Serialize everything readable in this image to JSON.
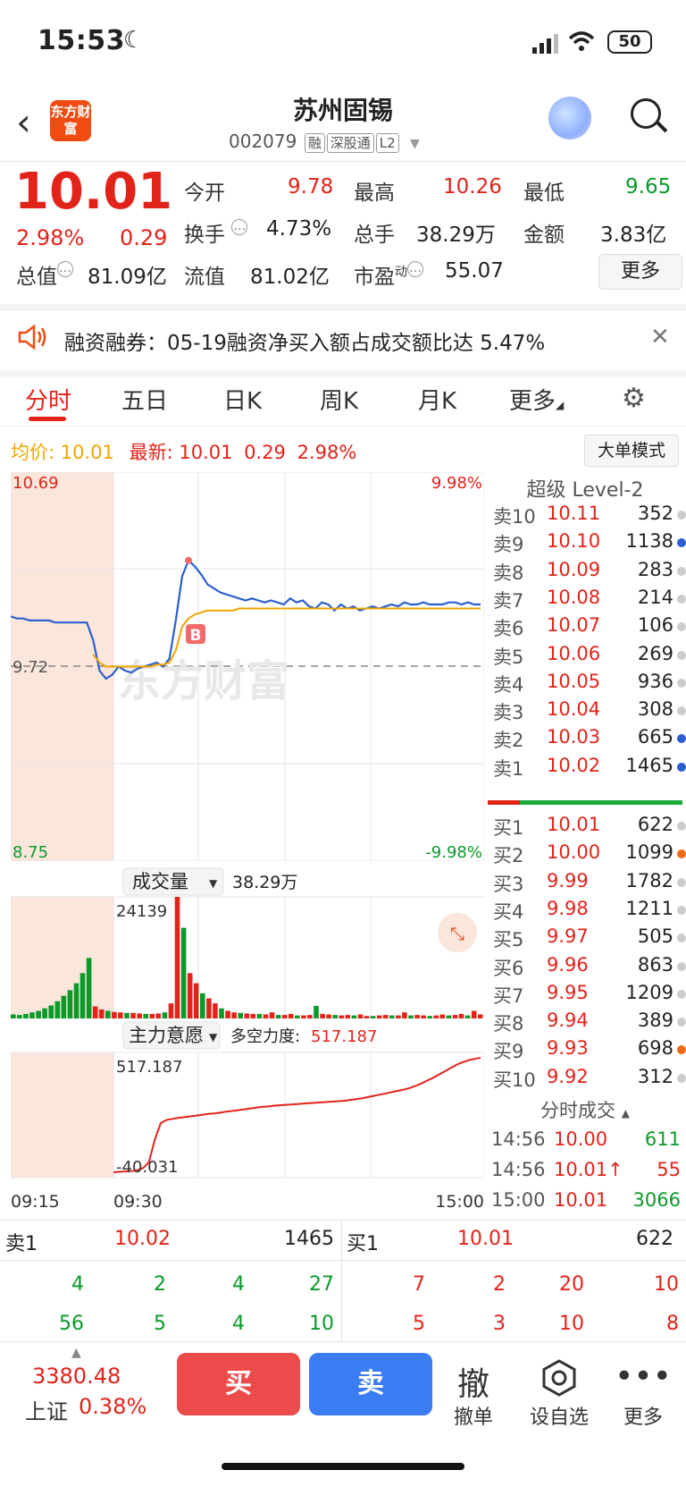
{
  "status_bar": {
    "time": "15:53",
    "battery": "50"
  },
  "header": {
    "logo_text": "东方财富",
    "stock_name": "苏州固锡",
    "stock_code": "002079",
    "tags": [
      "融",
      "深股通",
      "L2"
    ]
  },
  "quote": {
    "price": "10.01",
    "change_pct": "2.98%",
    "change": "0.29",
    "open_label": "今开",
    "open": "9.78",
    "high_label": "最高",
    "high": "10.26",
    "low_label": "最低",
    "low": "9.65",
    "turnover_label": "换手",
    "turnover": "4.73%",
    "volume_label": "总手",
    "volume": "38.29万",
    "amount_label": "金额",
    "amount": "3.83亿",
    "mktcap_label": "总值",
    "mktcap": "81.09亿",
    "float_label": "流值",
    "float_cap": "81.02亿",
    "pe_label": "市盈",
    "pe_sup": "动",
    "pe": "55.07",
    "more_label": "更多"
  },
  "notice": {
    "text": "融资融券：05-19融资净买入额占成交额比达 5.47%"
  },
  "tabs": [
    "分时",
    "五日",
    "日K",
    "周K",
    "月K",
    "更多"
  ],
  "avg_row": {
    "avg_label": "均价:",
    "avg": "10.01",
    "latest_label": "最新:",
    "latest": "10.01",
    "latest_chg": "0.29",
    "latest_pct": "2.98%",
    "big_mode": "大单模式"
  },
  "chart_data": [
    {
      "type": "line",
      "name": "intraday",
      "y_top_label": "10.69",
      "y_mid_label": "9.72",
      "y_bottom_label": "8.75",
      "pct_top_label": "9.98%",
      "pct_bottom_label": "-9.98%",
      "ylim": [
        8.75,
        10.69
      ],
      "prev_close": 9.72,
      "watermark": "东方财富",
      "buy_marker": "B",
      "x_labels": [
        "09:15",
        "09:30",
        "15:00"
      ],
      "series": [
        {
          "name": "price",
          "color": "#2b5fcf",
          "values": [
            9.97,
            9.96,
            9.96,
            9.95,
            9.95,
            9.95,
            9.95,
            9.94,
            9.94,
            9.94,
            9.94,
            9.94,
            9.94,
            9.85,
            9.7,
            9.66,
            9.68,
            9.72,
            9.7,
            9.69,
            9.71,
            9.72,
            9.73,
            9.74,
            9.72,
            9.76,
            9.95,
            10.17,
            10.25,
            10.22,
            10.18,
            10.13,
            10.11,
            10.09,
            10.08,
            10.07,
            10.06,
            10.05,
            10.06,
            10.05,
            10.04,
            10.05,
            10.04,
            10.03,
            10.06,
            10.04,
            10.05,
            10.02,
            10.01,
            10.04,
            10.03,
            10.0,
            10.03,
            10.01,
            10.02,
            10.0,
            10.01,
            10.02,
            10.01,
            10.02,
            10.03,
            10.02,
            10.04,
            10.03,
            10.03,
            10.04,
            10.03,
            10.03,
            10.03,
            10.04,
            10.04,
            10.03,
            10.04,
            10.03,
            10.03
          ]
        },
        {
          "name": "avg",
          "color": "#f0a500",
          "values": [
            null,
            null,
            null,
            null,
            null,
            null,
            null,
            null,
            null,
            null,
            null,
            null,
            null,
            9.78,
            9.74,
            9.72,
            9.72,
            9.72,
            9.72,
            9.72,
            9.72,
            9.72,
            9.72,
            9.73,
            9.73,
            9.74,
            9.8,
            9.92,
            9.96,
            9.98,
            9.99,
            10.0,
            10.0,
            10.0,
            10.0,
            10.0,
            10.01,
            10.01,
            10.01,
            10.01,
            10.01,
            10.01,
            10.01,
            10.01,
            10.01,
            10.01,
            10.01,
            10.01,
            10.01,
            10.01,
            10.01,
            10.01,
            10.01,
            10.01,
            10.01,
            10.01,
            10.01,
            10.01,
            10.01,
            10.01,
            10.01,
            10.01,
            10.01,
            10.01,
            10.01,
            10.01,
            10.01,
            10.01,
            10.01,
            10.01,
            10.01,
            10.01,
            10.01,
            10.01,
            10.01
          ]
        }
      ]
    },
    {
      "type": "bar",
      "name": "volume",
      "label": "成交量",
      "total": "38.29万",
      "max_label": "24139",
      "ylim": [
        0,
        24139
      ],
      "values": [
        800,
        700,
        900,
        1200,
        1500,
        2000,
        2600,
        3400,
        4500,
        5600,
        7000,
        9000,
        12000,
        2400,
        1800,
        1500,
        1300,
        1200,
        1100,
        1100,
        1000,
        900,
        900,
        1000,
        1200,
        3000,
        24139,
        18000,
        9000,
        7000,
        5000,
        4000,
        3000,
        2000,
        1500,
        1200,
        1100,
        1000,
        900,
        900,
        800,
        1200,
        700,
        700,
        900,
        600,
        600,
        700,
        2500,
        900,
        800,
        700,
        600,
        700,
        600,
        800,
        500,
        500,
        600,
        700,
        600,
        600,
        1200,
        600,
        700,
        600,
        500,
        600,
        800,
        600,
        700,
        900,
        600,
        1500,
        800
      ],
      "auction_colors": "green"
    },
    {
      "type": "line",
      "name": "main_force_intent",
      "label": "主力意愿",
      "strength_label": "多空力度:",
      "strength": "517.187",
      "max_label": "517.187",
      "min_label": "-40.031",
      "ylim": [
        -40.031,
        517.187
      ],
      "color": "#e2231a",
      "values": [
        -40,
        -38,
        -36,
        -35,
        -30,
        -20,
        10,
        120,
        200,
        215,
        220,
        225,
        228,
        232,
        236,
        240,
        244,
        246,
        250,
        255,
        258,
        262,
        266,
        270,
        274,
        278,
        280,
        284,
        286,
        288,
        290,
        292,
        294,
        296,
        298,
        300,
        302,
        304,
        306,
        308,
        312,
        316,
        320,
        326,
        332,
        338,
        344,
        350,
        356,
        362,
        370,
        380,
        392,
        406,
        420,
        436,
        452,
        468,
        484,
        496,
        506,
        512,
        517.187
      ]
    }
  ],
  "order_book": {
    "title": "超级 Level-2",
    "asks": [
      {
        "label": "卖10",
        "price": "10.11",
        "vol": "352",
        "dot": "#cccccc"
      },
      {
        "label": "卖9",
        "price": "10.10",
        "vol": "1138",
        "dot": "#2b5fcf"
      },
      {
        "label": "卖8",
        "price": "10.09",
        "vol": "283",
        "dot": "#cccccc"
      },
      {
        "label": "卖7",
        "price": "10.08",
        "vol": "214",
        "dot": "#cccccc"
      },
      {
        "label": "卖6",
        "price": "10.07",
        "vol": "106",
        "dot": "#cccccc"
      },
      {
        "label": "卖5",
        "price": "10.06",
        "vol": "269",
        "dot": "#cccccc"
      },
      {
        "label": "卖4",
        "price": "10.05",
        "vol": "936",
        "dot": "#cccccc"
      },
      {
        "label": "卖3",
        "price": "10.04",
        "vol": "308",
        "dot": "#cccccc"
      },
      {
        "label": "卖2",
        "price": "10.03",
        "vol": "665",
        "dot": "#2b5fcf"
      },
      {
        "label": "卖1",
        "price": "10.02",
        "vol": "1465",
        "dot": "#2b5fcf"
      }
    ],
    "bids": [
      {
        "label": "买1",
        "price": "10.01",
        "vol": "622",
        "dot": "#cccccc"
      },
      {
        "label": "买2",
        "price": "10.00",
        "vol": "1099",
        "dot": "#ef6a1a"
      },
      {
        "label": "买3",
        "price": "9.99",
        "vol": "1782",
        "dot": "#cccccc"
      },
      {
        "label": "买4",
        "price": "9.98",
        "vol": "1211",
        "dot": "#cccccc"
      },
      {
        "label": "买5",
        "price": "9.97",
        "vol": "505",
        "dot": "#cccccc"
      },
      {
        "label": "买6",
        "price": "9.96",
        "vol": "863",
        "dot": "#cccccc"
      },
      {
        "label": "买7",
        "price": "9.95",
        "vol": "1209",
        "dot": "#cccccc"
      },
      {
        "label": "买8",
        "price": "9.94",
        "vol": "389",
        "dot": "#cccccc"
      },
      {
        "label": "买9",
        "price": "9.93",
        "vol": "698",
        "dot": "#ef6a1a"
      },
      {
        "label": "买10",
        "price": "9.92",
        "vol": "312",
        "dot": "#cccccc"
      }
    ],
    "ticks_title": "分时成交",
    "ticks": [
      {
        "time": "14:56",
        "price": "10.00",
        "vol": "611",
        "vol_color": "green"
      },
      {
        "time": "14:56",
        "price": "10.01↑",
        "vol": "55",
        "vol_color": "red"
      },
      {
        "time": "15:00",
        "price": "10.01",
        "vol": "3066",
        "vol_color": "green"
      }
    ]
  },
  "level1": {
    "ask_label": "卖1",
    "ask_price": "10.02",
    "ask_vol": "1465",
    "bid_label": "买1",
    "bid_price": "10.01",
    "bid_vol": "622",
    "ask_queue": [
      "4",
      "2",
      "4",
      "27",
      "56",
      "5",
      "4",
      "10"
    ],
    "bid_queue": [
      "7",
      "2",
      "20",
      "10",
      "5",
      "3",
      "10",
      "8"
    ]
  },
  "bottom_bar": {
    "index_value": "3380.48",
    "index_name": "上证",
    "index_pct": "0.38%",
    "buy": "买",
    "sell": "卖",
    "cancel_icon": "撤",
    "cancel": "撤单",
    "watchlist": "设自选",
    "more": "更多"
  }
}
